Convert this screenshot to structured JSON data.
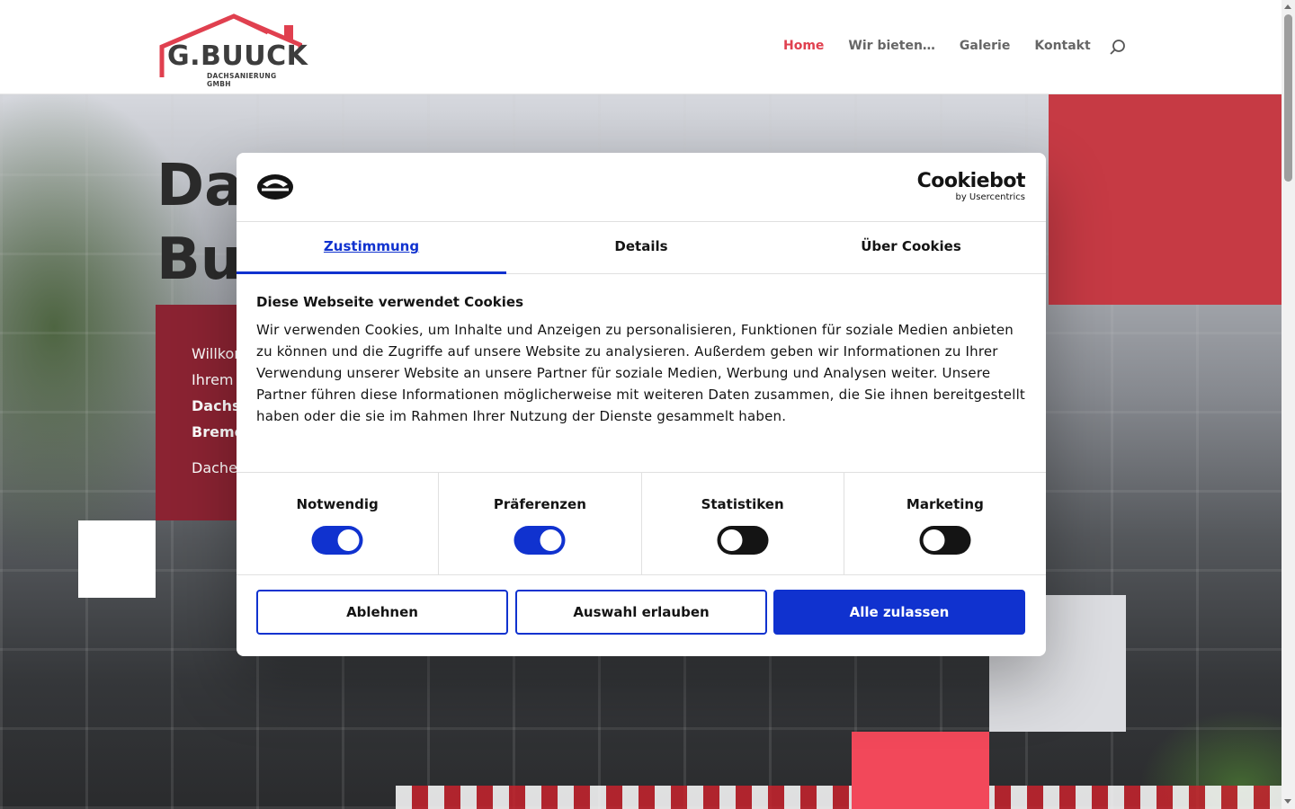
{
  "header": {
    "logo": {
      "name": "G.BUUCK",
      "subtitle": "DACHSANIERUNG GMBH"
    },
    "nav": [
      {
        "label": "Home",
        "active": true
      },
      {
        "label": "Wir bieten…",
        "active": false
      },
      {
        "label": "Galerie",
        "active": false
      },
      {
        "label": "Kontakt",
        "active": false
      }
    ],
    "search_icon": "search-icon"
  },
  "hero": {
    "title_visible": "Da\nBu",
    "welcome_line1": "Willkon",
    "welcome_line2": "Ihrem",
    "welcome_line3": "Dachs",
    "welcome_line4": "Breme",
    "welcome_sub": "Dache"
  },
  "cookie_dialog": {
    "brand": "Cookiebot",
    "brand_by": "by Usercentrics",
    "tabs": [
      {
        "label": "Zustimmung",
        "active": true
      },
      {
        "label": "Details",
        "active": false
      },
      {
        "label": "Über Cookies",
        "active": false
      }
    ],
    "heading": "Diese Webseite verwendet Cookies",
    "body": "Wir verwenden Cookies, um Inhalte und Anzeigen zu personalisieren, Funktionen für soziale Medien anbieten zu können und die Zugriffe auf unsere Website zu analysieren. Außerdem geben wir Informationen zu Ihrer Verwendung unserer Website an unsere Partner für soziale Medien, Werbung und Analysen weiter. Unsere Partner führen diese Informationen möglicherweise mit weiteren Daten zusammen, die Sie ihnen bereitgestellt haben oder die sie im Rahmen Ihrer Nutzung der Dienste gesammelt haben.",
    "toggles": [
      {
        "label": "Notwendig",
        "on": true
      },
      {
        "label": "Präferenzen",
        "on": true
      },
      {
        "label": "Statistiken",
        "on": false
      },
      {
        "label": "Marketing",
        "on": false
      }
    ],
    "buttons": {
      "decline": "Ablehnen",
      "allow_selection": "Auswahl erlauben",
      "allow_all": "Alle zulassen"
    }
  },
  "colors": {
    "accent_blue": "#1032cf",
    "nav_active": "#e0404f",
    "hero_box": "#8b2332",
    "red_block": "#c63a44",
    "pink_square": "#f2485a"
  }
}
